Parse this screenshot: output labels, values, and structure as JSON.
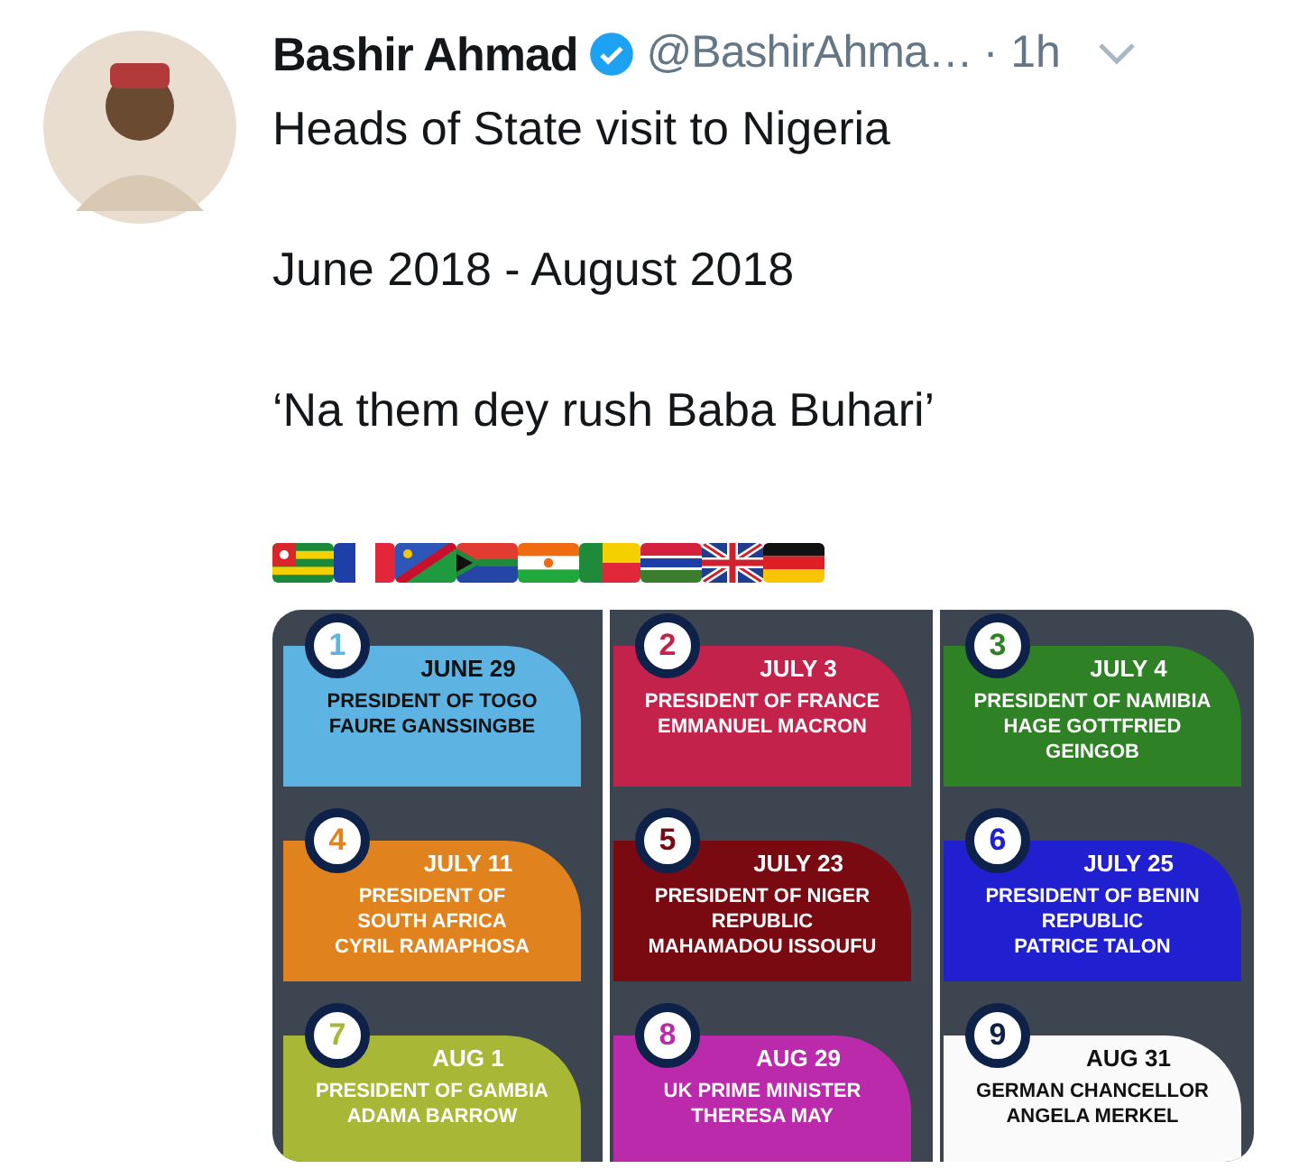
{
  "tweet": {
    "name": "Bashir Ahmad",
    "handle": "@BashirAhma…",
    "time": "· 1h",
    "verified": true,
    "paragraphs": [
      "Heads of State visit to Nigeria",
      "June 2018 - August 2018",
      "‘Na them dey rush Baba Buhari’"
    ]
  },
  "infographic": {
    "columns": [
      [
        {
          "number": "1",
          "date": "JUNE 29",
          "lines": [
            "PRESIDENT OF TOGO",
            "FAURE GANSSINGBE"
          ],
          "color": "#5db4e3",
          "dark_text": true
        },
        {
          "number": "4",
          "date": "JULY 11",
          "lines": [
            "PRESIDENT OF",
            "SOUTH AFRICA",
            "CYRIL RAMAPHOSA"
          ],
          "color": "#e0821e",
          "dark_text": false
        },
        {
          "number": "7",
          "date": "AUG 1",
          "lines": [
            "PRESIDENT OF GAMBIA",
            "ADAMA BARROW"
          ],
          "color": "#a8b735",
          "dark_text": false
        }
      ],
      [
        {
          "number": "2",
          "date": "JULY 3",
          "lines": [
            "PRESIDENT OF FRANCE",
            "EMMANUEL MACRON"
          ],
          "color": "#c3234a",
          "dark_text": false
        },
        {
          "number": "5",
          "date": "JULY 23",
          "lines": [
            "PRESIDENT OF NIGER",
            "REPUBLIC",
            "MAHAMADOU ISSOUFU"
          ],
          "color": "#7a0a12",
          "dark_text": false
        },
        {
          "number": "8",
          "date": "AUG 29",
          "lines": [
            "UK PRIME MINISTER",
            "THERESA MAY"
          ],
          "color": "#bb2aab",
          "dark_text": false
        }
      ],
      [
        {
          "number": "3",
          "date": "JULY 4",
          "lines": [
            "PRESIDENT OF NAMIBIA",
            "HAGE GOTTFRIED",
            "GEINGOB"
          ],
          "color": "#2e8124",
          "dark_text": false
        },
        {
          "number": "6",
          "date": "JULY 25",
          "lines": [
            "PRESIDENT OF BENIN",
            "REPUBLIC",
            "PATRICE TALON"
          ],
          "color": "#2020d0",
          "dark_text": false
        },
        {
          "number": "9",
          "date": "AUG 31",
          "lines": [
            "GERMAN CHANCELLOR",
            "ANGELA MERKEL"
          ],
          "color": "#fafafa",
          "dark_text": true
        }
      ]
    ]
  }
}
